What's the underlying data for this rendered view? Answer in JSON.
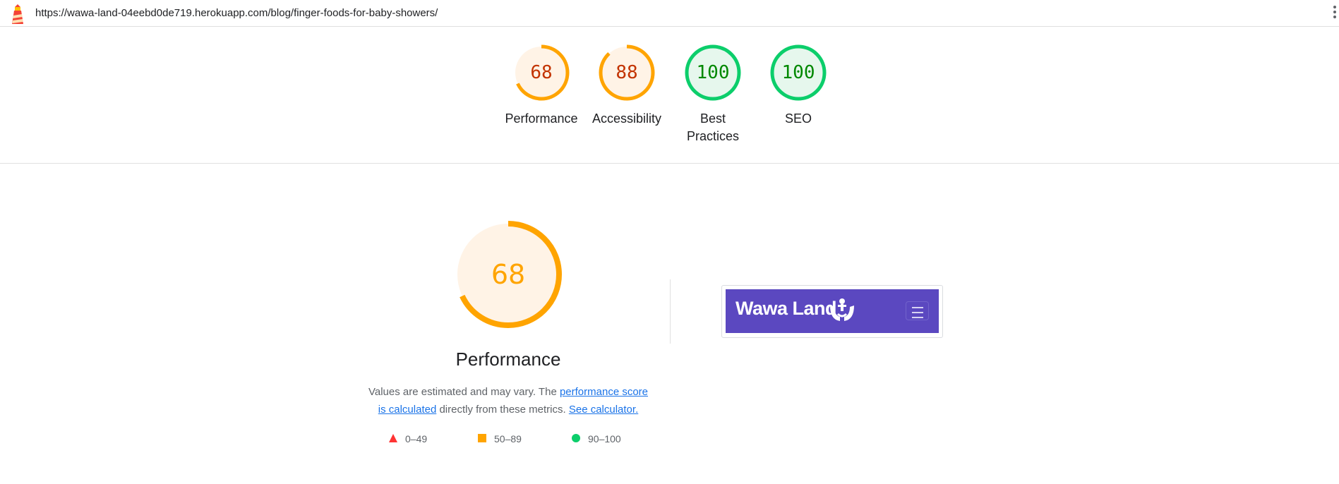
{
  "header": {
    "url": "https://wawa-land-04eebd0de719.herokuapp.com/blog/finger-foods-for-baby-showers/",
    "logo_icon": "lighthouse-icon",
    "menu_icon": "kebab-menu-icon"
  },
  "categories": [
    {
      "id": "performance",
      "score": "68",
      "label": "Performance",
      "value": 0.68,
      "status": "average"
    },
    {
      "id": "accessibility",
      "score": "88",
      "label": "Accessibility",
      "value": 0.88,
      "status": "average"
    },
    {
      "id": "best-practices",
      "score": "100",
      "label": "Best Practices",
      "value": 1.0,
      "status": "pass"
    },
    {
      "id": "seo",
      "score": "100",
      "label": "SEO",
      "value": 1.0,
      "status": "pass"
    }
  ],
  "performance": {
    "score": "68",
    "value": 0.68,
    "title": "Performance",
    "desc_part1": "Values are estimated and may vary. The ",
    "link_score": "performance score is calculated",
    "desc_part2": " directly from these metrics. ",
    "link_calc": "See calculator.",
    "legend": [
      {
        "range": "0–49",
        "shape": "triangle",
        "color": "#ff3333"
      },
      {
        "range": "50–89",
        "shape": "square",
        "color": "#ffa400"
      },
      {
        "range": "90–100",
        "shape": "circle",
        "color": "#0cce6b"
      }
    ]
  },
  "screenshot": {
    "brand": "Wawa Land",
    "brand_color": "#5b48c0",
    "menu_icon": "hamburger-icon"
  },
  "colors": {
    "average": "#ffa400",
    "average_text": "#c33300",
    "average_bg": "#fff3e6",
    "pass": "#0cce6b",
    "pass_text": "#008800",
    "pass_bg": "#e6f7ed"
  }
}
